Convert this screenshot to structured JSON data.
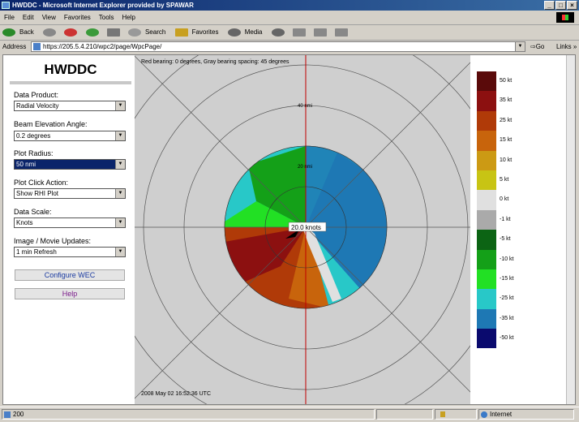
{
  "window": {
    "title": "HWDDC - Microsoft Internet Explorer provided by SPAWAR",
    "buttons": [
      "_",
      "□",
      "×"
    ]
  },
  "menu": [
    "File",
    "Edit",
    "View",
    "Favorites",
    "Tools",
    "Help"
  ],
  "toolbar": {
    "back": "Back",
    "search": "Search",
    "favorites": "Favorites",
    "media": "Media"
  },
  "address": {
    "label": "Address",
    "url": "https://205.5.4.210/wpc2/page/WpcPage/",
    "go": "Go",
    "links": "Links »"
  },
  "app": {
    "title": "HWDDC"
  },
  "controls": [
    {
      "label": "Data Product:",
      "value": "Radial Velocity"
    },
    {
      "label": "Beam Elevation Angle:",
      "value": "0.2 degrees"
    },
    {
      "label": "Plot Radius:",
      "value": "50 nmi"
    },
    {
      "label": "Plot Click Action:",
      "value": "Show RHI Plot"
    },
    {
      "label": "Data Scale:",
      "value": "Knots"
    },
    {
      "label": "Image / Movie Updates:",
      "value": "1 min Refresh"
    }
  ],
  "buttons": {
    "configure": "Configure WEC",
    "help": "Help"
  },
  "plot": {
    "bearing_text": "Red bearing: 0 degrees, Gray bearing spacing: 45 degrees",
    "ring_labels": [
      "40 nmi",
      "20 nmi"
    ],
    "cursor_label": "20.0 knots",
    "timestamp": "2008 May 02   16:52:36   UTC"
  },
  "colorscale": [
    {
      "label": "50 kt",
      "color": "#5a0a0a"
    },
    {
      "label": "35 kt",
      "color": "#8c1010"
    },
    {
      "label": "25 kt",
      "color": "#b03a08"
    },
    {
      "label": "15 kt",
      "color": "#c8640c"
    },
    {
      "label": "10 kt",
      "color": "#cc9a14"
    },
    {
      "label": "5 kt",
      "color": "#c8c414"
    },
    {
      "label": "0 kt",
      "color": "#e0e0e0"
    },
    {
      "label": "-1 kt",
      "color": "#aaaaaa"
    },
    {
      "label": "-5 kt",
      "color": "#0c6414"
    },
    {
      "label": "-10 kt",
      "color": "#14a018"
    },
    {
      "label": "-15 kt",
      "color": "#22e024"
    },
    {
      "label": "-25 kt",
      "color": "#28c8c8"
    },
    {
      "label": "-35 kt",
      "color": "#1e78b4"
    },
    {
      "label": "-50 kt",
      "color": "#0a0a6e"
    }
  ],
  "status": {
    "count": "200",
    "zone": "Internet"
  }
}
